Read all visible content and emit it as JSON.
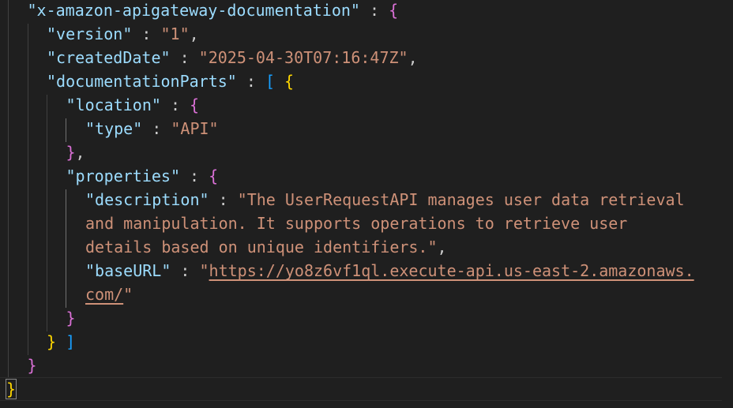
{
  "editor": {
    "lines": [
      {
        "indent": 1,
        "tokens": [
          [
            "key",
            "\"x-amazon-apigateway-documentation\""
          ],
          [
            "punc",
            " : "
          ],
          [
            "b2",
            "{"
          ]
        ]
      },
      {
        "indent": 2,
        "tokens": [
          [
            "key",
            "\"version\""
          ],
          [
            "punc",
            " : "
          ],
          [
            "str",
            "\"1\""
          ],
          [
            "punc",
            ","
          ]
        ]
      },
      {
        "indent": 2,
        "tokens": [
          [
            "key",
            "\"createdDate\""
          ],
          [
            "punc",
            " : "
          ],
          [
            "str",
            "\"2025-04-30T07:16:47Z\""
          ],
          [
            "punc",
            ","
          ]
        ]
      },
      {
        "indent": 2,
        "tokens": [
          [
            "key",
            "\"documentationParts\""
          ],
          [
            "punc",
            " : "
          ],
          [
            "b3",
            "["
          ],
          [
            "punc",
            " "
          ],
          [
            "b1",
            "{"
          ]
        ]
      },
      {
        "indent": 3,
        "tokens": [
          [
            "key",
            "\"location\""
          ],
          [
            "punc",
            " : "
          ],
          [
            "b2",
            "{"
          ]
        ]
      },
      {
        "indent": 4,
        "tokens": [
          [
            "key",
            "\"type\""
          ],
          [
            "punc",
            " : "
          ],
          [
            "str",
            "\"API\""
          ]
        ]
      },
      {
        "indent": 3,
        "tokens": [
          [
            "b2",
            "}"
          ],
          [
            "punc",
            ","
          ]
        ]
      },
      {
        "indent": 3,
        "tokens": [
          [
            "key",
            "\"properties\""
          ],
          [
            "punc",
            " : "
          ],
          [
            "b2",
            "{"
          ]
        ]
      },
      {
        "indent": 4,
        "tokens": [
          [
            "key",
            "\"description\""
          ],
          [
            "punc",
            " : "
          ],
          [
            "str",
            "\"The UserRequestAPI manages user data retrieval"
          ]
        ]
      },
      {
        "indent": 4,
        "tokens": [
          [
            "str",
            "and manipulation. It supports operations to retrieve user"
          ]
        ]
      },
      {
        "indent": 4,
        "tokens": [
          [
            "str",
            "details based on unique identifiers.\""
          ],
          [
            "punc",
            ","
          ]
        ]
      },
      {
        "indent": 4,
        "tokens": [
          [
            "key",
            "\"baseURL\""
          ],
          [
            "punc",
            " : "
          ],
          [
            "str",
            "\""
          ],
          [
            "url",
            "https://yo8z6vf1ql.execute-api.us-east-2.amazonaws."
          ]
        ]
      },
      {
        "indent": 4,
        "tokens": [
          [
            "url",
            "com/"
          ],
          [
            "str",
            "\""
          ]
        ]
      },
      {
        "indent": 3,
        "tokens": [
          [
            "b2",
            "}"
          ]
        ]
      },
      {
        "indent": 2,
        "tokens": [
          [
            "b1",
            "}"
          ],
          [
            "punc",
            " "
          ],
          [
            "b3",
            "]"
          ]
        ]
      },
      {
        "indent": 1,
        "tokens": [
          [
            "b2",
            "}"
          ]
        ]
      },
      {
        "indent": 0,
        "tokens": [
          [
            "b1",
            "}"
          ]
        ]
      }
    ]
  },
  "colors": {
    "background": "#1f1f1f",
    "key": "#9cdcfe",
    "string": "#ce9178",
    "bracket_gold": "#ffd700",
    "bracket_orchid": "#da70d6",
    "bracket_blue": "#179fff"
  }
}
